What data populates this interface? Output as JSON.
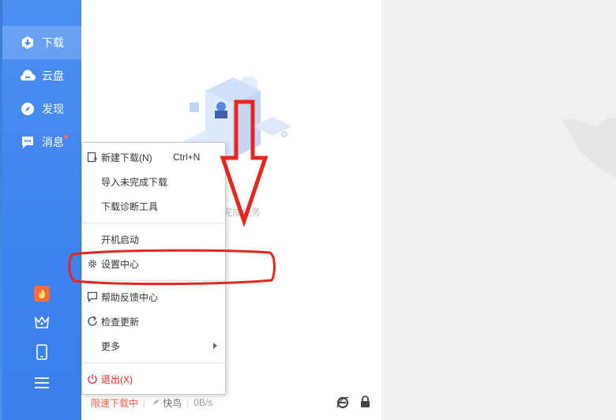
{
  "sidebar": {
    "items": [
      {
        "label": "下载",
        "icon": "download-icon",
        "active": true
      },
      {
        "label": "云盘",
        "icon": "cloud-icon",
        "active": false
      },
      {
        "label": "发现",
        "icon": "compass-icon",
        "active": false
      },
      {
        "label": "消息",
        "icon": "message-icon",
        "active": false,
        "badge_dot": true
      }
    ],
    "tools": [
      "game-icon",
      "crown-icon",
      "phone-icon",
      "hamburger-menu-icon"
    ]
  },
  "main": {
    "empty_text": "完成任务"
  },
  "menu": {
    "items": [
      {
        "label": "新建下载(N)",
        "shortcut": "Ctrl+N",
        "icon": "new-download-icon"
      },
      {
        "label": "导入未完成下载"
      },
      {
        "label": "下载诊断工具"
      },
      {
        "label": "开机启动"
      },
      {
        "label": "设置中心",
        "icon": "settings-gear-icon"
      },
      {
        "label": "帮助反馈中心",
        "icon": "feedback-icon"
      },
      {
        "label": "检查更新",
        "icon": "refresh-icon"
      },
      {
        "label": "更多",
        "has_submenu": true
      },
      {
        "label": "退出(X)",
        "icon": "power-icon"
      }
    ]
  },
  "status_bar": {
    "downloading": "限速下载中",
    "kuainiao": "快鸟",
    "speed": "0B/s"
  },
  "colors": {
    "sidebar_blue": "#3f83ee",
    "annotation_red": "#e8261f",
    "status_orange": "#ff5e45"
  }
}
